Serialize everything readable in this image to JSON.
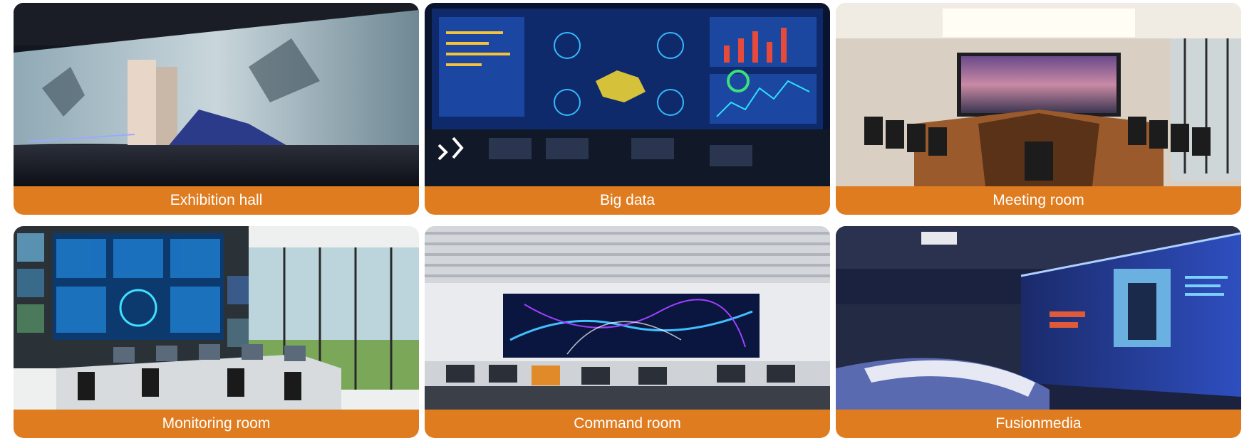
{
  "scenarios": [
    {
      "caption": "Exhibition hall"
    },
    {
      "caption": "Big data"
    },
    {
      "caption": "Meeting room"
    },
    {
      "caption": "Monitoring room"
    },
    {
      "caption": "Command room"
    },
    {
      "caption": "Fusionmedia"
    }
  ],
  "colors": {
    "caption_bar": "#e07c20",
    "caption_text": "#ffffff"
  }
}
